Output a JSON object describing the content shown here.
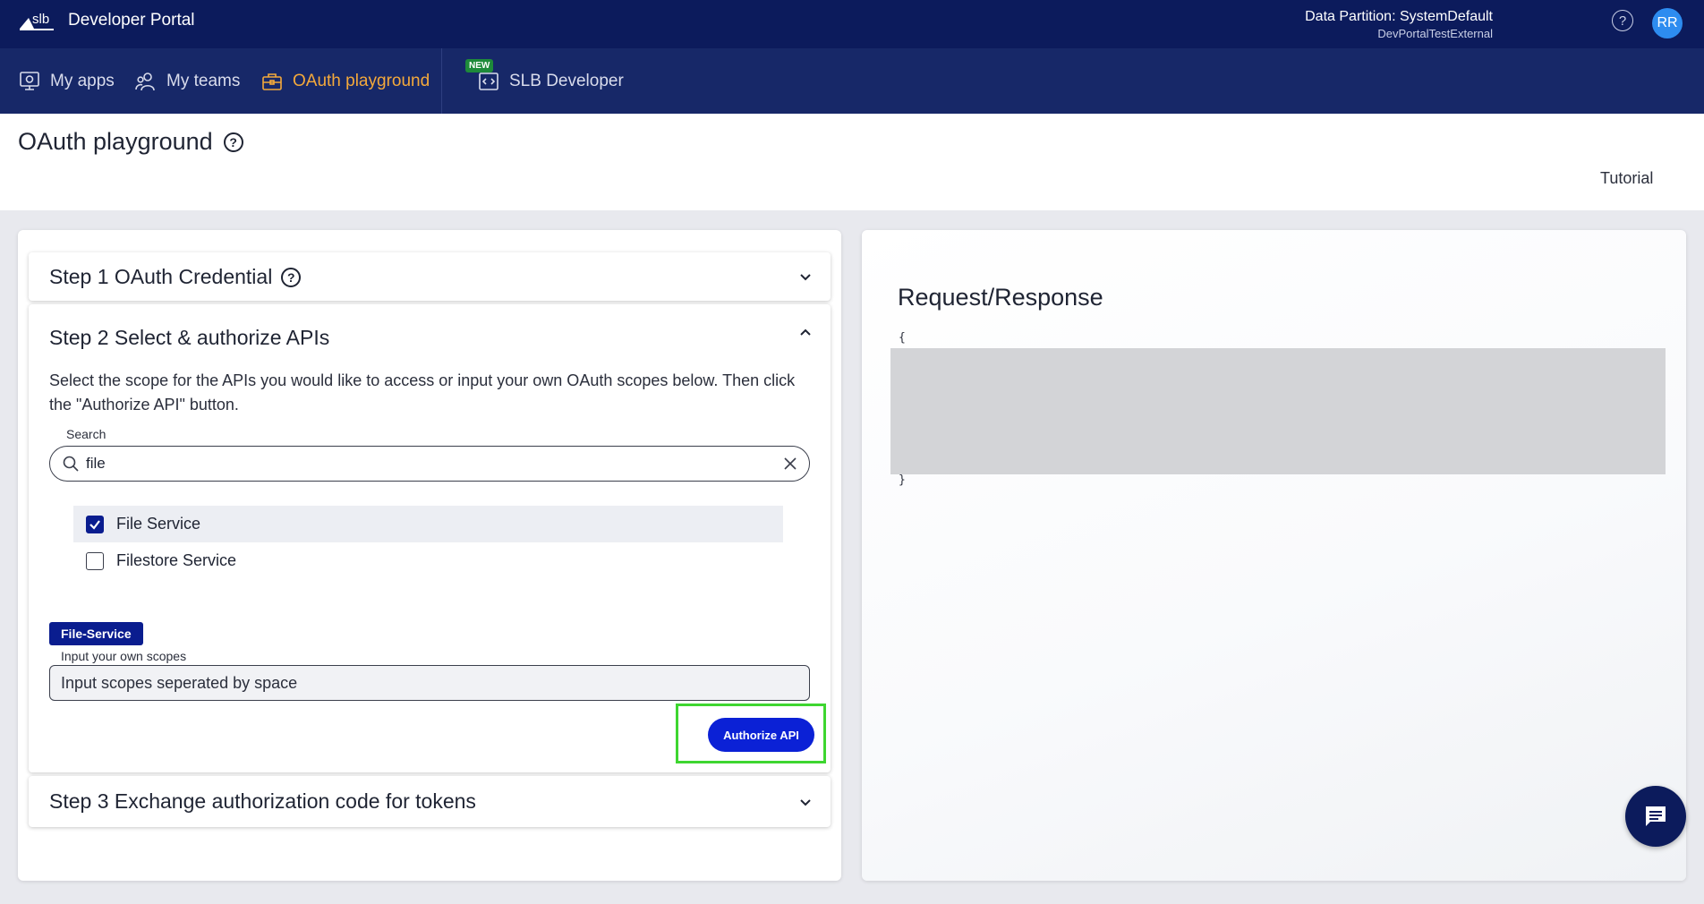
{
  "app": {
    "title": "Developer Portal",
    "partition_label": "Data Partition: SystemDefault",
    "partition_sub": "DevPortalTestExternal",
    "help_glyph": "?",
    "avatar_initials": "RR"
  },
  "nav": {
    "items": [
      {
        "label": "My apps",
        "icon": "my-apps-icon"
      },
      {
        "label": "My teams",
        "icon": "my-teams-icon"
      },
      {
        "label": "OAuth playground",
        "icon": "briefcase-icon",
        "active": true
      },
      {
        "label": "SLB Developer",
        "icon": "code-window-icon",
        "badge": "NEW"
      }
    ],
    "active_color": "#f4a93b"
  },
  "page": {
    "title": "OAuth playground",
    "help_glyph": "?",
    "tutorial_link": "Tutorial"
  },
  "steps": {
    "step1": {
      "title": "Step 1 OAuth Credential",
      "help_glyph": "?"
    },
    "step2": {
      "title": "Step 2 Select & authorize APIs",
      "description": "Select the scope for the APIs you would like to access or input your own OAuth scopes below. Then click the \"Authorize API\" button.",
      "search": {
        "label": "Search",
        "value": "file"
      },
      "options": [
        {
          "label": "File Service",
          "checked": true
        },
        {
          "label": "Filestore Service",
          "checked": false
        }
      ],
      "selected_tag": "File-Service",
      "scopes": {
        "label": "Input your own scopes",
        "placeholder": "Input scopes seperated by space"
      },
      "authorize_button": "Authorize API"
    },
    "step3": {
      "title": "Step 3 Exchange authorization code for tokens"
    }
  },
  "response": {
    "title": "Request/Response",
    "open_brace": "{",
    "close_brace": "}"
  },
  "colors": {
    "topbar": "#0c1b5c",
    "navbar": "#172868",
    "primary": "#0b21d6",
    "tag": "#0a1d8f",
    "highlight": "#3ed630"
  }
}
